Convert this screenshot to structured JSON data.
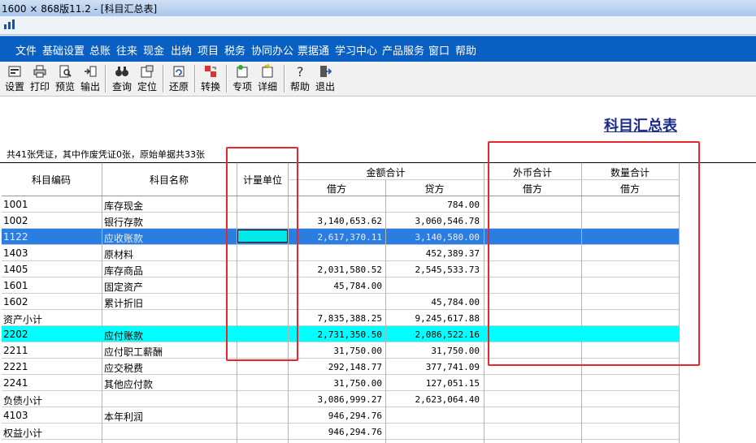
{
  "window": {
    "title": "1600 × 868版11.2 - [科目汇总表]"
  },
  "menu": [
    "文件",
    "基础设置",
    "总账",
    "往来",
    "现金",
    "出纳",
    "项目",
    "税务",
    "协同办公",
    "票据通",
    "学习中心",
    "产品服务",
    "窗口",
    "帮助"
  ],
  "toolbar": [
    {
      "label": "设置",
      "icon": "settings-icon"
    },
    {
      "label": "打印",
      "icon": "printer-icon"
    },
    {
      "label": "预览",
      "icon": "preview-icon"
    },
    {
      "label": "输出",
      "icon": "export-icon"
    },
    {
      "label": "查询",
      "icon": "binoculars-icon"
    },
    {
      "label": "定位",
      "icon": "locate-icon"
    },
    {
      "label": "还原",
      "icon": "restore-icon"
    },
    {
      "label": "转换",
      "icon": "convert-icon"
    },
    {
      "label": "专项",
      "icon": "special-icon"
    },
    {
      "label": "详细",
      "icon": "detail-icon"
    },
    {
      "label": "帮助",
      "icon": "help-icon"
    },
    {
      "label": "退出",
      "icon": "exit-icon"
    }
  ],
  "report": {
    "title": "科目汇总表",
    "summary": "共41张凭证，其中作废凭证0张，原始单据共33张"
  },
  "table": {
    "headers": {
      "code": "科目编码",
      "name": "科目名称",
      "unit": "计量单位",
      "amount_total": "金额合计",
      "debit": "借方",
      "credit": "贷方",
      "fx_total": "外币合计",
      "fx_debit": "借方",
      "qty_total": "数量合计",
      "qty_debit": "借方"
    },
    "rows": [
      {
        "code": "1001",
        "name": "库存现金",
        "debit": "",
        "credit": "784.00",
        "style": ""
      },
      {
        "code": "1002",
        "name": "银行存款",
        "debit": "3,140,653.62",
        "credit": "3,060,546.78",
        "style": ""
      },
      {
        "code": "1122",
        "name": "应收账款",
        "debit": "2,617,370.11",
        "credit": "3,140,580.00",
        "style": "selected"
      },
      {
        "code": "1403",
        "name": "原材料",
        "debit": "",
        "credit": "452,389.37",
        "style": ""
      },
      {
        "code": "1405",
        "name": "库存商品",
        "debit": "2,031,580.52",
        "credit": "2,545,533.73",
        "style": ""
      },
      {
        "code": "1601",
        "name": "固定资产",
        "debit": "45,784.00",
        "credit": "",
        "style": ""
      },
      {
        "code": "1602",
        "name": "累计折旧",
        "debit": "",
        "credit": "45,784.00",
        "style": ""
      },
      {
        "code": "资产小计",
        "name": "",
        "debit": "7,835,388.25",
        "credit": "9,245,617.88",
        "style": ""
      },
      {
        "code": "2202",
        "name": "应付账款",
        "debit": "2,731,350.50",
        "credit": "2,086,522.16",
        "style": "cyan"
      },
      {
        "code": "2211",
        "name": "应付职工薪酬",
        "debit": "31,750.00",
        "credit": "31,750.00",
        "style": ""
      },
      {
        "code": "2221",
        "name": "应交税费",
        "debit": "292,148.77",
        "credit": "377,741.09",
        "style": ""
      },
      {
        "code": "2241",
        "name": "其他应付款",
        "debit": "31,750.00",
        "credit": "127,051.15",
        "style": ""
      },
      {
        "code": "负债小计",
        "name": "",
        "debit": "3,086,999.27",
        "credit": "2,623,064.40",
        "style": ""
      },
      {
        "code": "4103",
        "name": "本年利润",
        "debit": "946,294.76",
        "credit": "",
        "style": ""
      },
      {
        "code": "权益小计",
        "name": "",
        "debit": "946,294.76",
        "credit": "",
        "style": ""
      }
    ]
  },
  "colors": {
    "menubar": "#0a5fc3",
    "selected_row": "#2a7de1",
    "highlight_row": "#00ffff",
    "annotation": "#e8262d",
    "title": "#1c2a8c"
  }
}
